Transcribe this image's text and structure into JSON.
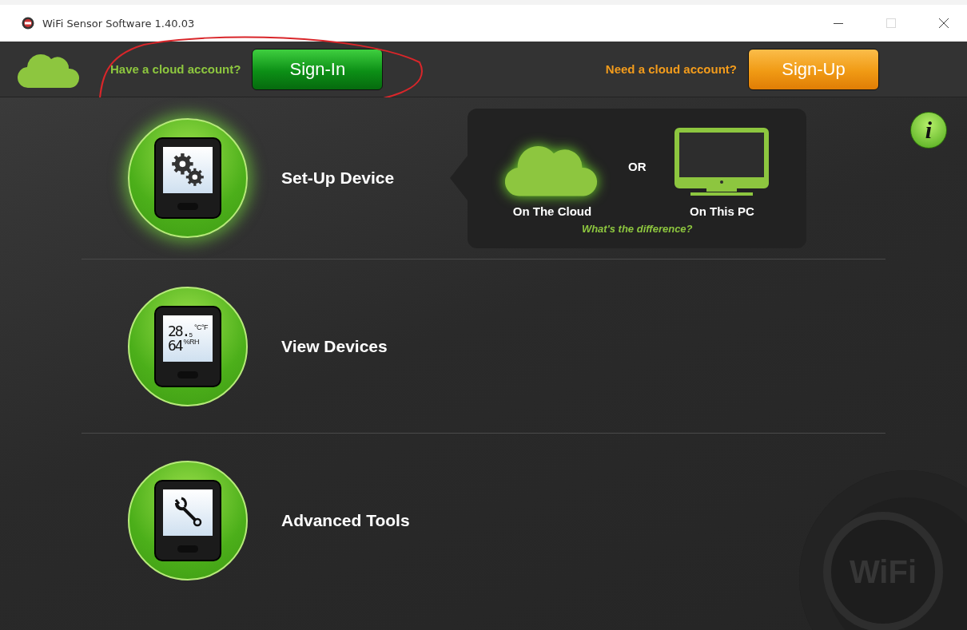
{
  "window": {
    "title": "WiFi Sensor Software 1.40.03",
    "maximize_disabled": true
  },
  "account_bar": {
    "sign_in_prompt": "Have a cloud account?",
    "sign_in_button": "Sign-In",
    "sign_up_prompt": "Need a cloud account?",
    "sign_up_button": "Sign-Up"
  },
  "menu": [
    {
      "kind": "setup",
      "label": "Set-Up Device",
      "selected": true
    },
    {
      "kind": "view",
      "label": "View Devices",
      "selected": false,
      "screen_lines": [
        "28.",
        "64"
      ],
      "screen_small": "5",
      "screen_units": [
        "°C°F",
        "%RH"
      ]
    },
    {
      "kind": "tools",
      "label": "Advanced Tools",
      "selected": false
    }
  ],
  "setup_popup": {
    "options": [
      {
        "kind": "cloud",
        "label": "On The Cloud",
        "selected": true
      },
      {
        "kind": "pc",
        "label": "On This PC",
        "selected": false
      }
    ],
    "separator": "OR",
    "link": "What's the difference?"
  },
  "info_button": "i",
  "background_logo": "WiFi"
}
